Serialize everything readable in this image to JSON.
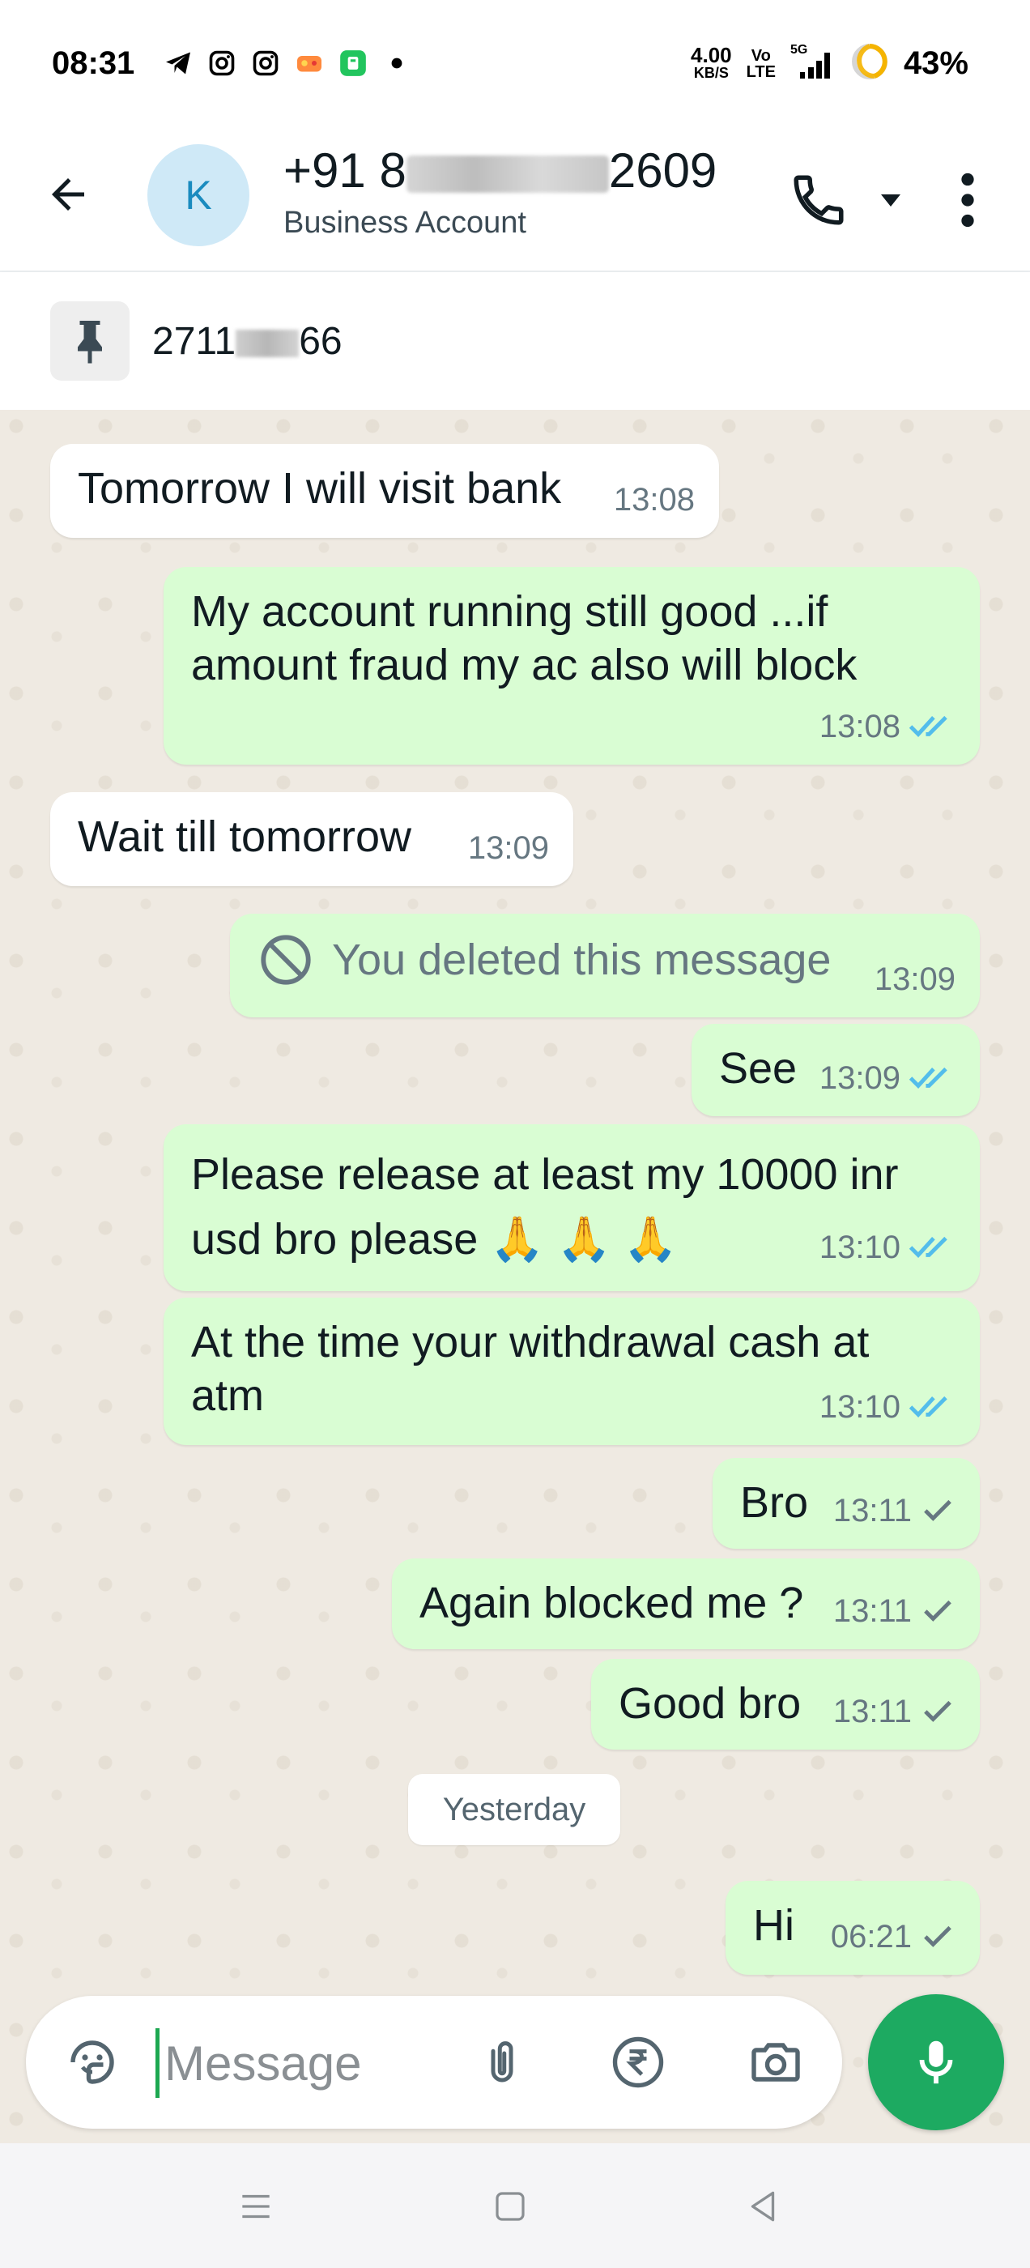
{
  "status_bar": {
    "time": "08:31",
    "net_speed_value": "4.00",
    "net_speed_unit": "KB/S",
    "volte_top": "Vo",
    "volte_bottom": "LTE",
    "network": "5G",
    "battery": "43%",
    "icons": [
      "telegram-icon",
      "instagram-icon",
      "instagram-icon",
      "game-icon",
      "app-icon",
      "dot-icon"
    ]
  },
  "header": {
    "avatar_letter": "K",
    "contact_name_prefix": "+91 8",
    "contact_name_suffix": "2609",
    "contact_subtitle": "Business Account"
  },
  "pinned": {
    "text_prefix": "2711",
    "text_suffix": "66"
  },
  "messages": [
    {
      "dir": "in",
      "text": "Tomorrow I will visit bank",
      "time": "13:08",
      "status": ""
    },
    {
      "dir": "out",
      "text": "My account running still good ...if amount fraud my ac also will block",
      "time": "13:08",
      "status": "read"
    },
    {
      "dir": "in",
      "text": "Wait till tomorrow",
      "time": "13:09",
      "status": ""
    },
    {
      "dir": "out",
      "text": "You deleted this message",
      "time": "13:09",
      "status": "deleted"
    },
    {
      "dir": "out",
      "text": "See",
      "time": "13:09",
      "status": "read"
    },
    {
      "dir": "out",
      "text": "Please release at least my 10000 inr usd bro please 🙏 🙏 🙏",
      "time": "13:10",
      "status": "read"
    },
    {
      "dir": "out",
      "text": "At the time your withdrawal cash at atm",
      "time": "13:10",
      "status": "read"
    },
    {
      "dir": "out",
      "text": "Bro",
      "time": "13:11",
      "status": "sent"
    },
    {
      "dir": "out",
      "text": "Again blocked me ?",
      "time": "13:11",
      "status": "sent"
    },
    {
      "dir": "out",
      "text": "Good bro",
      "time": "13:11",
      "status": "sent"
    },
    {
      "dir": "out",
      "text": "Hi",
      "time": "06:21",
      "status": "sent"
    }
  ],
  "date_chip": "Yesterday",
  "composer": {
    "placeholder": "Message"
  },
  "colors": {
    "accent_green": "#1daa61",
    "outgoing_bubble": "#d9fdd3",
    "read_tick": "#53bdeb",
    "chat_bg": "#efeae2"
  }
}
